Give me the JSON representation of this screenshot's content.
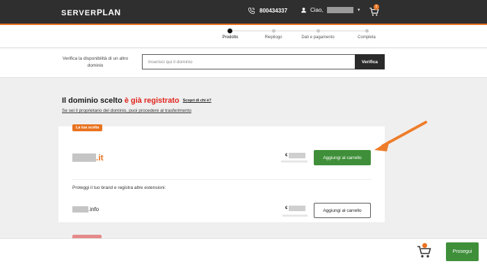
{
  "header": {
    "logo_left": "SERVER",
    "logo_right": "PLAN",
    "phone": "800434337",
    "greeting": "Ciao,",
    "cart_count": "0",
    "accent": "#e9731f"
  },
  "steps": [
    {
      "label": "Prodotto",
      "active": true
    },
    {
      "label": "Riepilogo",
      "active": false
    },
    {
      "label": "Dati e pagamento",
      "active": false
    },
    {
      "label": "Completa",
      "active": false
    }
  ],
  "verify": {
    "label": "Verifica la disponibilità di un altro dominio",
    "placeholder": "Inserisci qui il dominio",
    "button": "Verifica"
  },
  "result": {
    "heading_prefix": "Il dominio scelto ",
    "heading_highlight": "è già registrato",
    "who_link": "Scopri di chi è?",
    "transfer_text": "Se sei il proprietario del dominio, puoi procedere al trasferimento"
  },
  "card": {
    "chip": "La tua scelta",
    "main_ext": ".it",
    "currency": "€",
    "add_main": "Aggiungi al carrello",
    "protect": "Proteggi il tuo brand e registra altre estensioni:",
    "alt_ext": ".info",
    "add_alt": "Aggiungi al carrello"
  },
  "bottom": {
    "continue": "Prosegui"
  }
}
